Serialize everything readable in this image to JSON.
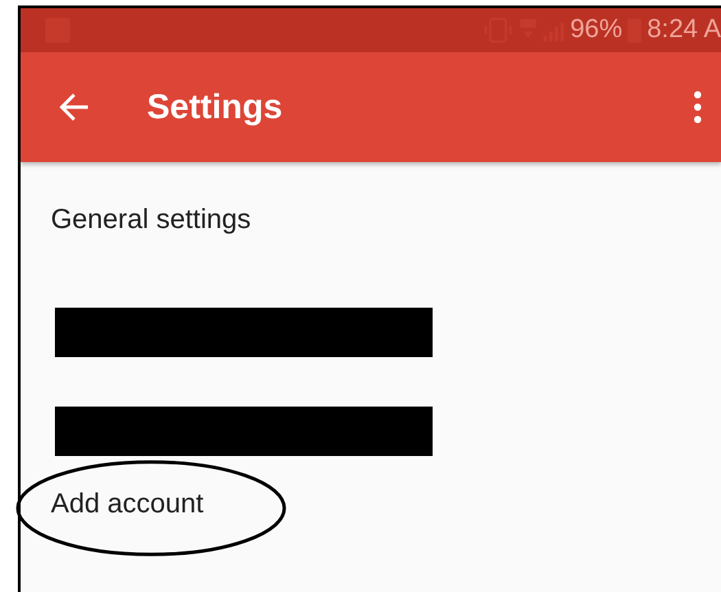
{
  "status_bar": {
    "battery": "96%",
    "time": "8:24 A"
  },
  "toolbar": {
    "title": "Settings"
  },
  "items": [
    {
      "kind": "label",
      "text": "General settings"
    },
    {
      "kind": "redacted"
    },
    {
      "kind": "redacted"
    },
    {
      "kind": "label",
      "text": "Add account",
      "circled": true
    }
  ]
}
